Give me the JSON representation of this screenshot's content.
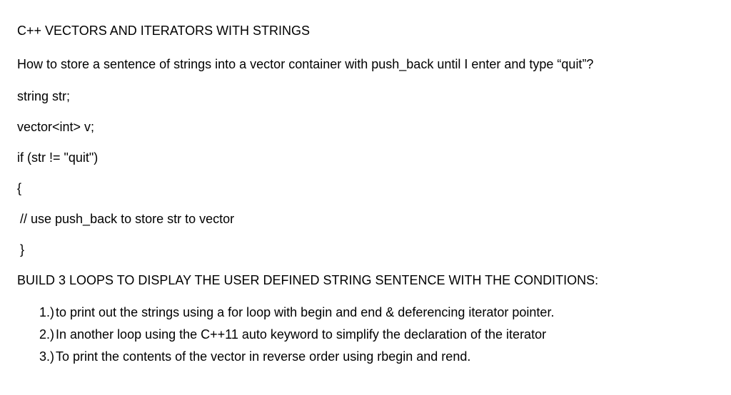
{
  "title": "C++ VECTORS AND ITERATORS WITH STRINGS",
  "intro": "How to store a sentence of strings into a vector container with push_back until I enter and type “quit”?",
  "code": {
    "line1": "string str;",
    "line2": "vector<int> v;",
    "line3": "if (str != \"quit\")",
    "line4": "{",
    "line5": " // use push_back to store str to vector",
    "line6": " }"
  },
  "section_header": "BUILD 3 LOOPS TO DISPLAY THE USER DEFINED STRING SENTENCE WITH THE CONDITIONS:",
  "list": {
    "item1": " to print out the strings using a for loop with begin and end & deferencing iterator pointer.",
    "item2": " In another loop using the C++11 auto keyword to simplify the declaration of the iterator",
    "item3": " To print the contents of the vector in reverse order using rbegin and rend."
  }
}
